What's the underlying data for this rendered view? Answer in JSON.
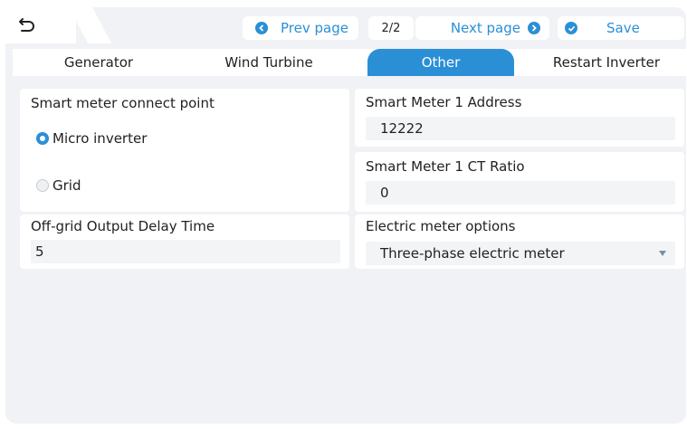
{
  "topbar": {
    "back_icon": "back-arrow-icon",
    "prev_label": "Prev page",
    "page_indicator": "2/2",
    "next_label": "Next page",
    "save_label": "Save"
  },
  "tabs": [
    {
      "label": "Generator",
      "active": false
    },
    {
      "label": "Wind Turbine",
      "active": false
    },
    {
      "label": "Other",
      "active": true
    },
    {
      "label": "Restart Inverter",
      "active": false
    }
  ],
  "connect_point": {
    "title": "Smart meter connect point",
    "options": [
      {
        "label": "Micro inverter",
        "selected": true
      },
      {
        "label": "Grid",
        "selected": false
      }
    ]
  },
  "delay_time": {
    "title": "Off-grid Output Delay Time",
    "value": "5"
  },
  "meter_address": {
    "title": "Smart Meter 1 Address",
    "value": "12222"
  },
  "ct_ratio": {
    "title": "Smart Meter 1 CT Ratio",
    "value": "0"
  },
  "meter_options": {
    "title": "Electric meter options",
    "value": "Three-phase electric meter"
  },
  "colors": {
    "accent": "#2b8fd6",
    "background": "#f0f2f5"
  }
}
